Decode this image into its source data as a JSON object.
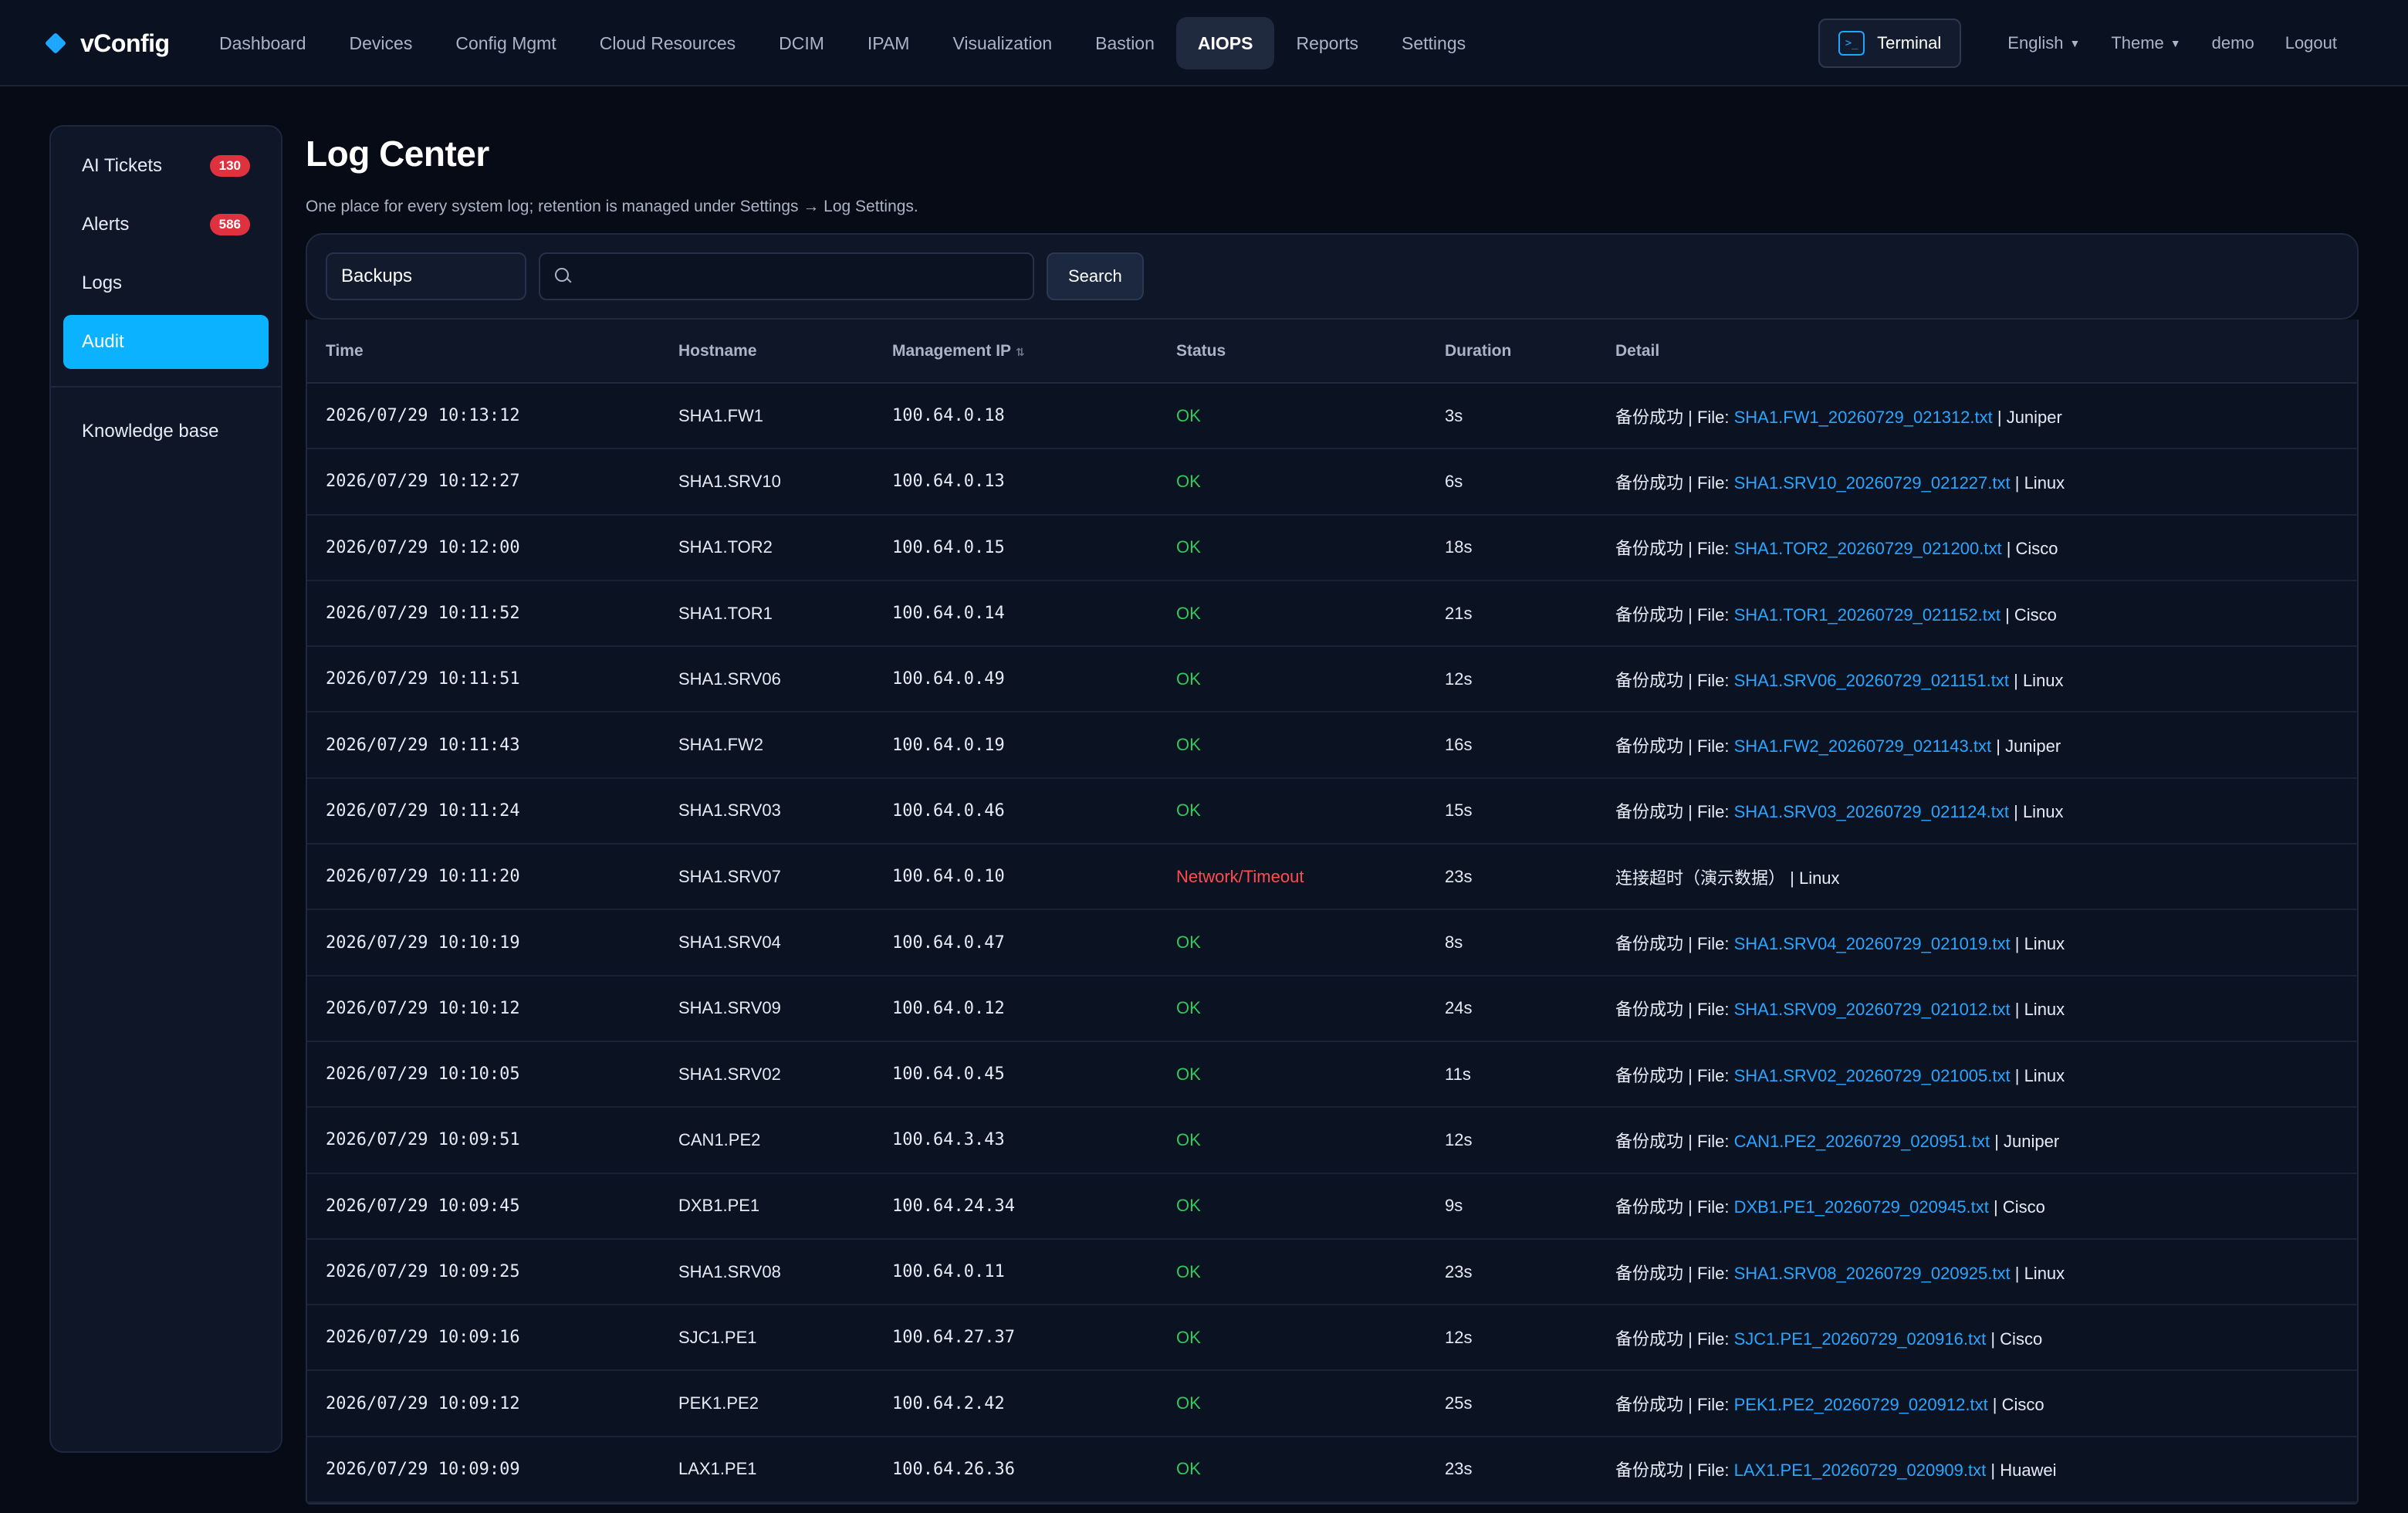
{
  "brand": {
    "name": "vConfig"
  },
  "nav": [
    {
      "label": "Dashboard",
      "active": false
    },
    {
      "label": "Devices",
      "active": false
    },
    {
      "label": "Config Mgmt",
      "active": false
    },
    {
      "label": "Cloud Resources",
      "active": false
    },
    {
      "label": "DCIM",
      "active": false
    },
    {
      "label": "IPAM",
      "active": false
    },
    {
      "label": "Visualization",
      "active": false
    },
    {
      "label": "Bastion",
      "active": false
    },
    {
      "label": "AIOPS",
      "active": true
    },
    {
      "label": "Reports",
      "active": false
    },
    {
      "label": "Settings",
      "active": false
    }
  ],
  "topright": {
    "terminal_label": "Terminal",
    "terminal_icon": ">_",
    "language": "English",
    "theme": "Theme",
    "user": "demo",
    "logout": "Logout"
  },
  "sidebar": {
    "items": [
      {
        "label": "AI Tickets",
        "badge": "130",
        "active": false
      },
      {
        "label": "Alerts",
        "badge": "586",
        "active": false
      },
      {
        "label": "Logs",
        "badge": "",
        "active": false
      },
      {
        "label": "Audit",
        "badge": "",
        "active": true
      }
    ],
    "bottom": [
      {
        "label": "Knowledge base"
      }
    ]
  },
  "page": {
    "title": "Log Center",
    "subtitle": "One place for every system log; retention is managed under Settings → Log Settings."
  },
  "filters": {
    "category": "Backups",
    "search_value": "",
    "search_placeholder": "",
    "search_button": "Search"
  },
  "table": {
    "columns": [
      "Time",
      "Hostname",
      "Management IP",
      "Status",
      "Duration",
      "Detail"
    ],
    "rows": [
      {
        "time": "2026/07/29 10:13:12",
        "host": "SHA1.FW1",
        "ip": "100.64.0.18",
        "status": "OK",
        "duration": "3s",
        "detail_prefix": "备份成功 | File: ",
        "file": "SHA1.FW1_20260729_021312.txt",
        "vendor": " | Juniper"
      },
      {
        "time": "2026/07/29 10:12:27",
        "host": "SHA1.SRV10",
        "ip": "100.64.0.13",
        "status": "OK",
        "duration": "6s",
        "detail_prefix": "备份成功 | File: ",
        "file": "SHA1.SRV10_20260729_021227.txt",
        "vendor": " | Linux"
      },
      {
        "time": "2026/07/29 10:12:00",
        "host": "SHA1.TOR2",
        "ip": "100.64.0.15",
        "status": "OK",
        "duration": "18s",
        "detail_prefix": "备份成功 | File: ",
        "file": "SHA1.TOR2_20260729_021200.txt",
        "vendor": " | Cisco"
      },
      {
        "time": "2026/07/29 10:11:52",
        "host": "SHA1.TOR1",
        "ip": "100.64.0.14",
        "status": "OK",
        "duration": "21s",
        "detail_prefix": "备份成功 | File: ",
        "file": "SHA1.TOR1_20260729_021152.txt",
        "vendor": " | Cisco"
      },
      {
        "time": "2026/07/29 10:11:51",
        "host": "SHA1.SRV06",
        "ip": "100.64.0.49",
        "status": "OK",
        "duration": "12s",
        "detail_prefix": "备份成功 | File: ",
        "file": "SHA1.SRV06_20260729_021151.txt",
        "vendor": " | Linux"
      },
      {
        "time": "2026/07/29 10:11:43",
        "host": "SHA1.FW2",
        "ip": "100.64.0.19",
        "status": "OK",
        "duration": "16s",
        "detail_prefix": "备份成功 | File: ",
        "file": "SHA1.FW2_20260729_021143.txt",
        "vendor": " | Juniper"
      },
      {
        "time": "2026/07/29 10:11:24",
        "host": "SHA1.SRV03",
        "ip": "100.64.0.46",
        "status": "OK",
        "duration": "15s",
        "detail_prefix": "备份成功 | File: ",
        "file": "SHA1.SRV03_20260729_021124.txt",
        "vendor": " | Linux"
      },
      {
        "time": "2026/07/29 10:11:20",
        "host": "SHA1.SRV07",
        "ip": "100.64.0.10",
        "status": "Network/Timeout",
        "duration": "23s",
        "detail_prefix": "连接超时（演示数据） ",
        "file": "",
        "vendor": "| Linux"
      },
      {
        "time": "2026/07/29 10:10:19",
        "host": "SHA1.SRV04",
        "ip": "100.64.0.47",
        "status": "OK",
        "duration": "8s",
        "detail_prefix": "备份成功 | File: ",
        "file": "SHA1.SRV04_20260729_021019.txt",
        "vendor": " | Linux"
      },
      {
        "time": "2026/07/29 10:10:12",
        "host": "SHA1.SRV09",
        "ip": "100.64.0.12",
        "status": "OK",
        "duration": "24s",
        "detail_prefix": "备份成功 | File: ",
        "file": "SHA1.SRV09_20260729_021012.txt",
        "vendor": " | Linux"
      },
      {
        "time": "2026/07/29 10:10:05",
        "host": "SHA1.SRV02",
        "ip": "100.64.0.45",
        "status": "OK",
        "duration": "11s",
        "detail_prefix": "备份成功 | File: ",
        "file": "SHA1.SRV02_20260729_021005.txt",
        "vendor": " | Linux"
      },
      {
        "time": "2026/07/29 10:09:51",
        "host": "CAN1.PE2",
        "ip": "100.64.3.43",
        "status": "OK",
        "duration": "12s",
        "detail_prefix": "备份成功 | File: ",
        "file": "CAN1.PE2_20260729_020951.txt",
        "vendor": " | Juniper"
      },
      {
        "time": "2026/07/29 10:09:45",
        "host": "DXB1.PE1",
        "ip": "100.64.24.34",
        "status": "OK",
        "duration": "9s",
        "detail_prefix": "备份成功 | File: ",
        "file": "DXB1.PE1_20260729_020945.txt",
        "vendor": " | Cisco"
      },
      {
        "time": "2026/07/29 10:09:25",
        "host": "SHA1.SRV08",
        "ip": "100.64.0.11",
        "status": "OK",
        "duration": "23s",
        "detail_prefix": "备份成功 | File: ",
        "file": "SHA1.SRV08_20260729_020925.txt",
        "vendor": " | Linux"
      },
      {
        "time": "2026/07/29 10:09:16",
        "host": "SJC1.PE1",
        "ip": "100.64.27.37",
        "status": "OK",
        "duration": "12s",
        "detail_prefix": "备份成功 | File: ",
        "file": "SJC1.PE1_20260729_020916.txt",
        "vendor": " | Cisco"
      },
      {
        "time": "2026/07/29 10:09:12",
        "host": "PEK1.PE2",
        "ip": "100.64.2.42",
        "status": "OK",
        "duration": "25s",
        "detail_prefix": "备份成功 | File: ",
        "file": "PEK1.PE2_20260729_020912.txt",
        "vendor": " | Cisco"
      },
      {
        "time": "2026/07/29 10:09:09",
        "host": "LAX1.PE1",
        "ip": "100.64.26.36",
        "status": "OK",
        "duration": "23s",
        "detail_prefix": "备份成功 | File: ",
        "file": "LAX1.PE1_20260729_020909.txt",
        "vendor": " | Huawei"
      }
    ]
  },
  "colors": {
    "accent": "#0ab2ff",
    "ok": "#34c759",
    "error": "#ff4d4f",
    "link": "#2ba6ff",
    "badge": "#e0323e"
  }
}
